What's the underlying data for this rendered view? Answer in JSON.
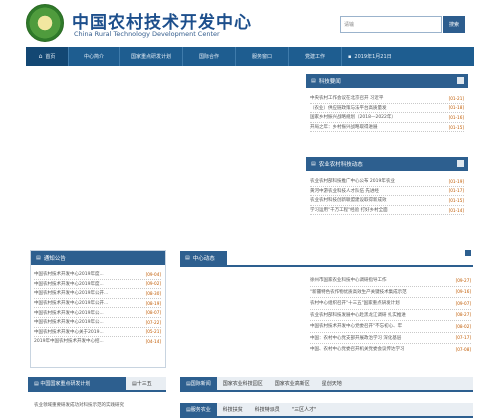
{
  "header": {
    "title_cn": "中国农村技术开发中心",
    "title_en": "China Rural Technology Development Center",
    "search_placeholder": "请输",
    "search_button": "搜索"
  },
  "nav": {
    "items": [
      {
        "label": "首页",
        "active": true
      },
      {
        "label": "中心简介",
        "active": false
      },
      {
        "label": "国家重点研发计划",
        "active": false
      },
      {
        "label": "国际合作",
        "active": false
      },
      {
        "label": "服务窗口",
        "active": false
      },
      {
        "label": "党建工作",
        "active": false
      },
      {
        "label": "2019年1月21日",
        "active": false
      }
    ]
  },
  "panel_news": {
    "title": "科技要闻",
    "items": [
      {
        "text": "中央农村工作会议在北京召开 习近平",
        "date": "[01-21]"
      },
      {
        "text": "（农业）供应链政策与法平台高质量发",
        "date": "[01-18]"
      },
      {
        "text": "国家乡村振兴战略规划（2018—2022年）",
        "date": "[01-16]"
      },
      {
        "text": "开局之年：乡村振兴战略取得进展",
        "date": "[01-15]"
      }
    ]
  },
  "panel_rural": {
    "title": "农业农村科技动态",
    "items": [
      {
        "text": "农业农村部科技推广中心公布 2019年农业",
        "date": "[01-19]"
      },
      {
        "text": "黄河中游农业科技人才队伍 先进经",
        "date": "[01-17]"
      },
      {
        "text": "农业农村科技创新联盟建设取得新成效",
        "date": "[01-15]"
      },
      {
        "text": "学习运用\"千万工程\"经验 打好乡村全面",
        "date": "[01-14]"
      }
    ]
  },
  "panel_notice": {
    "title": "通知公告",
    "items": [
      {
        "text": "中国农村技术开发中心2019年度...",
        "date": "[09-04]"
      },
      {
        "text": "中国农村技术开发中心2019年度...",
        "date": "[09-02]"
      },
      {
        "text": "中国农村技术开发中心2019年公开...",
        "date": "[08-30]"
      },
      {
        "text": "中国农村技术开发中心2019年公开...",
        "date": "[08-19]"
      },
      {
        "text": "中国农村技术开发中心2019年公...",
        "date": "[08-07]"
      },
      {
        "text": "中国农村技术开发中心2019年公...",
        "date": "[07-22]"
      },
      {
        "text": "中国农村技术开发中心关于2019...",
        "date": "[05-21]"
      },
      {
        "text": "2019年中国农村技术开发中心招...",
        "date": "[04-14]"
      }
    ]
  },
  "panel_center": {
    "title": "中心动态",
    "items": [
      {
        "text": "徐州市国家农业科技中心调研指导工作",
        "date": "[09-27]"
      },
      {
        "text": "\"新疆特色农作物优质高效生产关键技术集成示范",
        "date": "[09-16]"
      },
      {
        "text": "农村中心组织召开\"十三五\"国家重点研发计划",
        "date": "[09-07]"
      },
      {
        "text": "农业农村部科技发展中心赴黑龙江调研 扎实推进",
        "date": "[08-27]"
      },
      {
        "text": "中国农村技术开发中心党委召开\"不忘初心、牢",
        "date": "[08-02]"
      },
      {
        "text": "中国：农村中心党支部开展政治学习 深化基层",
        "date": "[07-17]"
      },
      {
        "text": "中国、农村中心党委召开机关党委会议传达学习",
        "date": "[07-08]"
      }
    ]
  },
  "bottom_left": {
    "tabs": [
      {
        "label": "中国国家重点研发计划",
        "active": true
      },
      {
        "label": "十三五",
        "active": false
      }
    ],
    "line1": "农业领域重要研发成功对科技示范的实践研究"
  },
  "bottom_right_tabs1": [
    {
      "label": "国际新闻",
      "active": true
    },
    {
      "label": "国家农业科技园区",
      "active": false
    },
    {
      "label": "国家农业高新区",
      "active": false
    },
    {
      "label": "星创天地",
      "active": false
    }
  ],
  "bottom_right_tabs2": [
    {
      "label": "服务农业",
      "active": true
    },
    {
      "label": "科技扶贫",
      "active": false
    },
    {
      "label": "科技特派员",
      "active": false
    },
    {
      "label": "\"三区人才\"",
      "active": false
    }
  ],
  "colors": {
    "brand_blue": "#1e5d90",
    "panel_blue": "#2d5f8f",
    "date_orange": "#c05a00"
  }
}
